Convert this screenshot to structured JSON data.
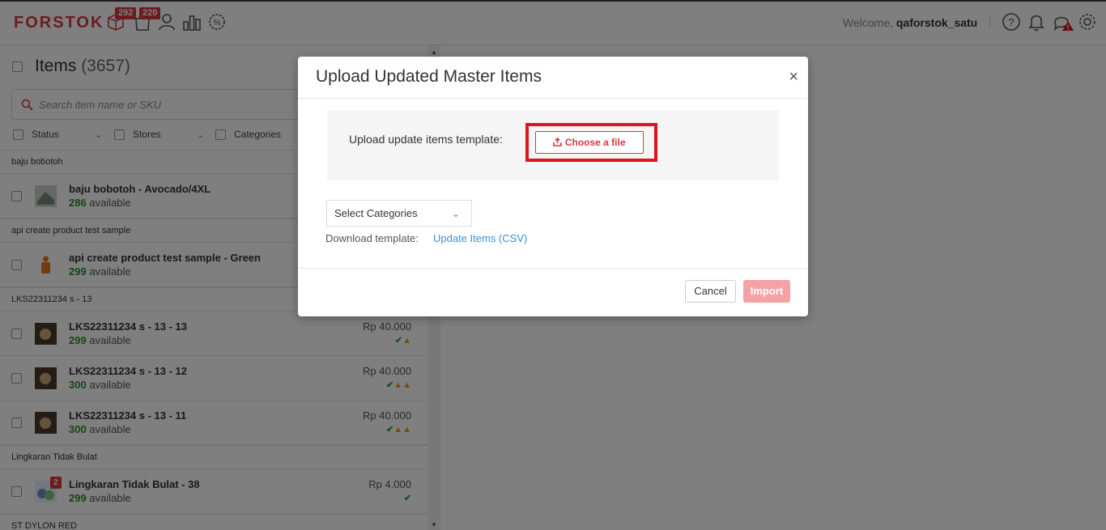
{
  "header": {
    "logo": "FORSTOK",
    "badges": {
      "orders": "292",
      "returns": "220"
    },
    "icons": [
      "box-icon",
      "bag-icon",
      "user-icon",
      "chart-icon",
      "promo-icon",
      "help-icon",
      "bell-icon",
      "chat-alert-icon",
      "gear-icon"
    ],
    "welcome_prefix": "Welcome,",
    "username": "qaforstok_satu"
  },
  "items_panel": {
    "title": "Items",
    "count": "(3657)",
    "search_placeholder": "Search item name or SKU",
    "filters": [
      "Status",
      "Stores",
      "Categories"
    ],
    "groups": [
      {
        "name": "baju bobotoh",
        "rows": [
          {
            "name": "baju bobotoh - Avocado/4XL",
            "qty": "286",
            "avail": "available",
            "price": "",
            "status": ""
          }
        ]
      },
      {
        "name": "api create product test sample",
        "rows": [
          {
            "name": "api create product test sample - Green",
            "qty": "299",
            "avail": "available",
            "price": "",
            "status": ""
          }
        ]
      },
      {
        "name": "LKS22311234 s - 13",
        "rows": [
          {
            "name": "LKS22311234 s - 13 - 13",
            "qty": "299",
            "avail": "available",
            "price": "Rp 40.000",
            "status": "ok-warn"
          },
          {
            "name": "LKS22311234 s - 13 - 12",
            "qty": "300",
            "avail": "available",
            "price": "Rp 40.000",
            "status": "ok-warn-warn"
          },
          {
            "name": "LKS22311234 s - 13 - 11",
            "qty": "300",
            "avail": "available",
            "price": "Rp 40.000",
            "status": "ok-warn-warn"
          }
        ]
      },
      {
        "name": "Lingkaran Tidak Bulat",
        "rows": [
          {
            "name": "Lingkaran Tidak Bulat - 38",
            "qty": "299",
            "avail": "available",
            "price": "Rp 4.000",
            "status": "ok",
            "thumb_badge": "2"
          }
        ]
      },
      {
        "name": "ST DYLON RED",
        "rows": []
      }
    ]
  },
  "modal": {
    "title": "Upload Updated Master Items",
    "close_label": "×",
    "upload_label": "Upload update items template:",
    "choose_file_label": "Choose a file",
    "select_categories": "Select Categories",
    "download_label": "Download template:",
    "download_link": "Update Items (CSV)",
    "cancel_label": "Cancel",
    "import_label": "Import"
  },
  "colors": {
    "brand": "#d9363e",
    "link": "#3b8fd6",
    "available": "#2e8b2e",
    "import_disabled": "#f5a1a5"
  }
}
